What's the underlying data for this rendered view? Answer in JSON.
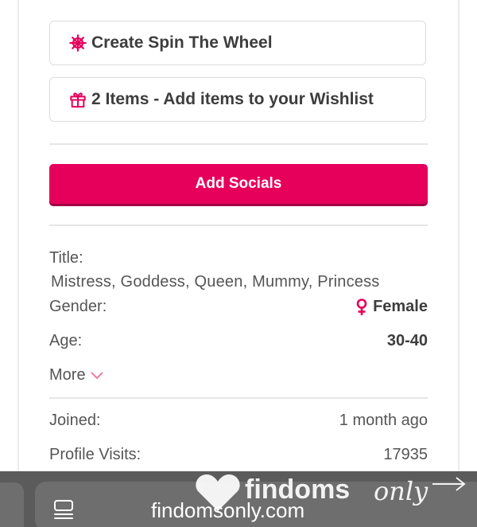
{
  "actions": {
    "spin_wheel_label": "Create Spin The Wheel",
    "wishlist_label": "2 Items - Add items to your Wishlist"
  },
  "socials": {
    "button_label": "Add Socials"
  },
  "profile": {
    "title_label": "Title:",
    "title_value": "Mistress, Goddess, Queen, Mummy, Princess",
    "gender_label": "Gender:",
    "gender_value": "Female",
    "age_label": "Age:",
    "age_value": "30-40",
    "more_label": "More",
    "joined_label": "Joined:",
    "joined_value": "1 month ago",
    "visits_label": "Profile Visits:",
    "visits_value": "17935"
  },
  "browser": {
    "url": "findomsonly.com"
  },
  "brand": {
    "logo_text": "findoms",
    "logo_script": "only"
  },
  "colors": {
    "accent": "#e6005c",
    "text": "#3d3d3d",
    "muted": "#555555",
    "border": "#dcdcdc"
  },
  "icons": {
    "spin_wheel": "ship-wheel-icon",
    "wishlist": "gift-icon",
    "gender": "female-symbol-icon",
    "more": "chevron-down-icon",
    "menu": "reader-menu-icon"
  }
}
